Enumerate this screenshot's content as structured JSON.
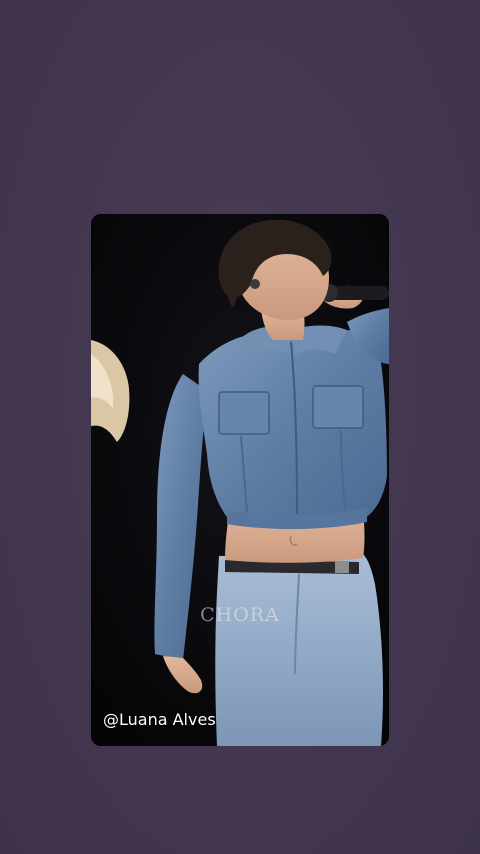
{
  "story": {
    "background_color": "#45394f",
    "watermark": "CHORA",
    "credit": "@Luana Alves"
  }
}
